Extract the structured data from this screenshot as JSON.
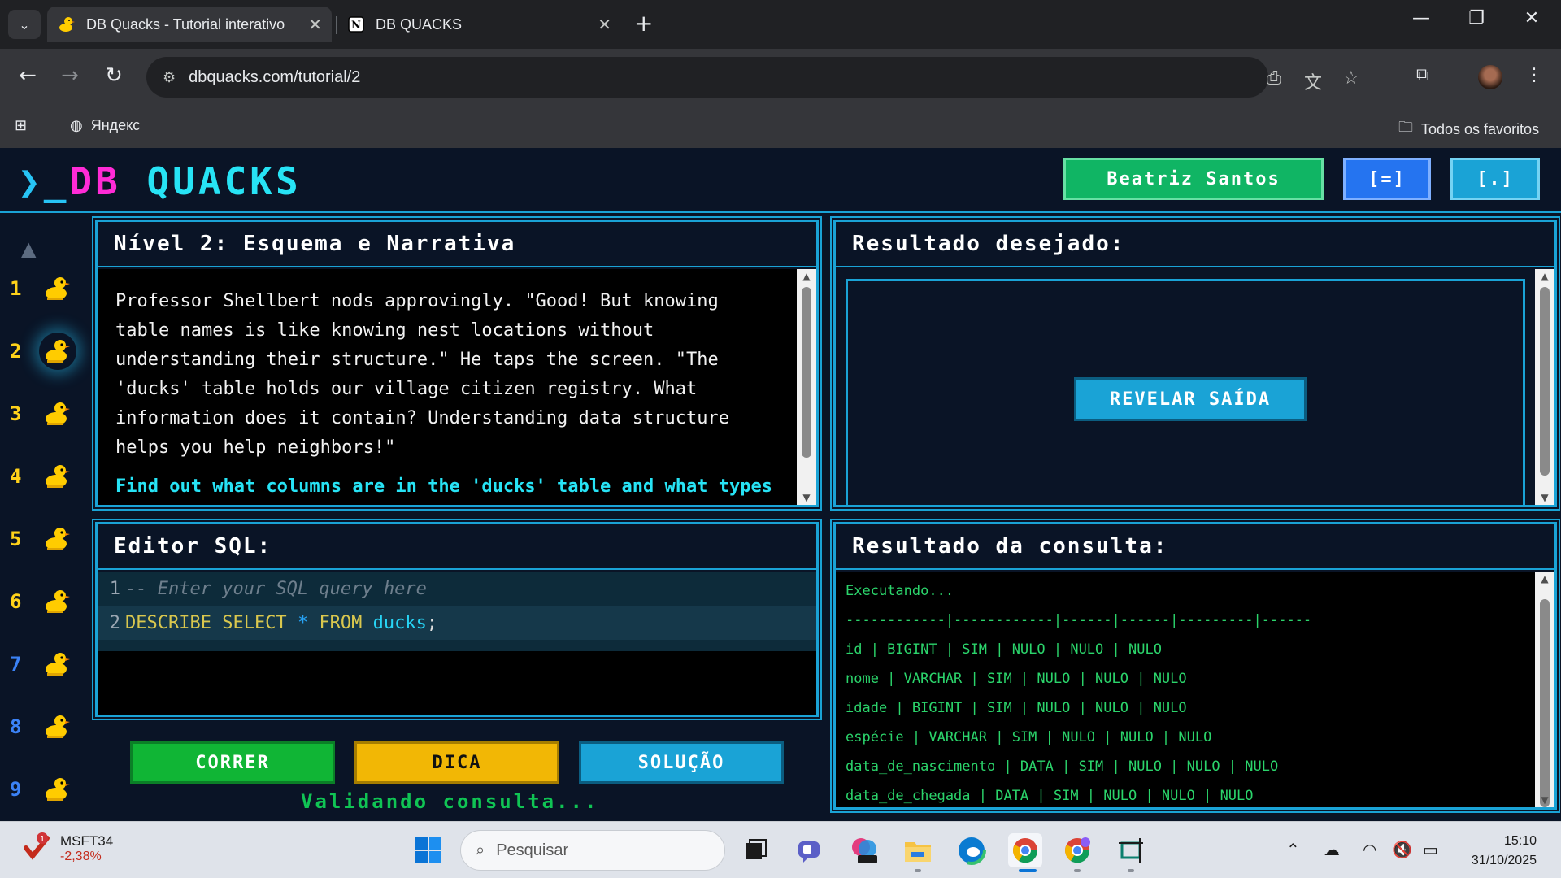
{
  "browser": {
    "tabs": [
      {
        "title": "DB Quacks - Tutorial interativo",
        "active": true,
        "favicon": "duck-icon"
      },
      {
        "title": "DB QUACKS",
        "active": false,
        "favicon": "notion-icon"
      }
    ],
    "url": "dbquacks.com/tutorial/2",
    "bookmarks": [
      {
        "label": "Яндекс",
        "icon": "globe-icon"
      }
    ],
    "all_bookmarks_label": "Todos os favoritos"
  },
  "app": {
    "logo_prompt": "❯_",
    "logo_db": "DB",
    "logo_quacks": "QUACKS",
    "user_button": "Beatriz Santos",
    "layout_button": "[=]",
    "other_button": "[.]",
    "levels": [
      {
        "num": "1"
      },
      {
        "num": "2"
      },
      {
        "num": "3"
      },
      {
        "num": "4"
      },
      {
        "num": "5"
      },
      {
        "num": "6"
      },
      {
        "num": "7"
      },
      {
        "num": "8"
      },
      {
        "num": "9"
      }
    ],
    "current_level": 2,
    "narrative": {
      "title": "Nível 2: Esquema e Narrativa",
      "text": "Professor Shellbert nods approvingly. \"Good! But knowing table names is like knowing nest locations without understanding their structure.\" He taps the screen. \"The 'ducks' table holds our village citizen registry. What information does it contain? Understanding data structure helps you help neighbors!\"",
      "task": "Find out what columns are in the 'ducks' table and what types of data they contain - you'll be examining the structure of"
    },
    "desired": {
      "title": "Resultado desejado:",
      "reveal_button": "REVELAR SAÍDA"
    },
    "editor": {
      "title": "Editor SQL:",
      "line1_num": "1",
      "line1": "-- Enter your SQL query here",
      "line2_num": "2",
      "line2_kw1": "DESCRIBE SELECT",
      "line2_op": "*",
      "line2_kw2": "FROM",
      "line2_id": "ducks",
      "line2_end": ";"
    },
    "actions": {
      "run": "CORRER",
      "hint": "DICA",
      "solution": "SOLUÇÃO",
      "status": "Validando consulta..."
    },
    "result": {
      "title": "Resultado da consulta:",
      "lines": [
        "Executando...",
        "------------|------------|------|------|---------|------",
        "id | BIGINT | SIM | NULO | NULO | NULO",
        "nome | VARCHAR | SIM | NULO | NULO | NULO",
        "idade | BIGINT | SIM | NULO | NULO | NULO",
        "espécie | VARCHAR | SIM | NULO | NULO | NULO",
        "data_de_nascimento | DATA | SIM | NULO | NULO | NULO",
        "data_de_chegada | DATA | SIM | NULO | NULO | NULO"
      ]
    }
  },
  "taskbar": {
    "stock_name": "MSFT34",
    "stock_change": "-2,38%",
    "stock_badge": "1",
    "search_placeholder": "Pesquisar",
    "time": "15:10",
    "date": "31/10/2025"
  }
}
